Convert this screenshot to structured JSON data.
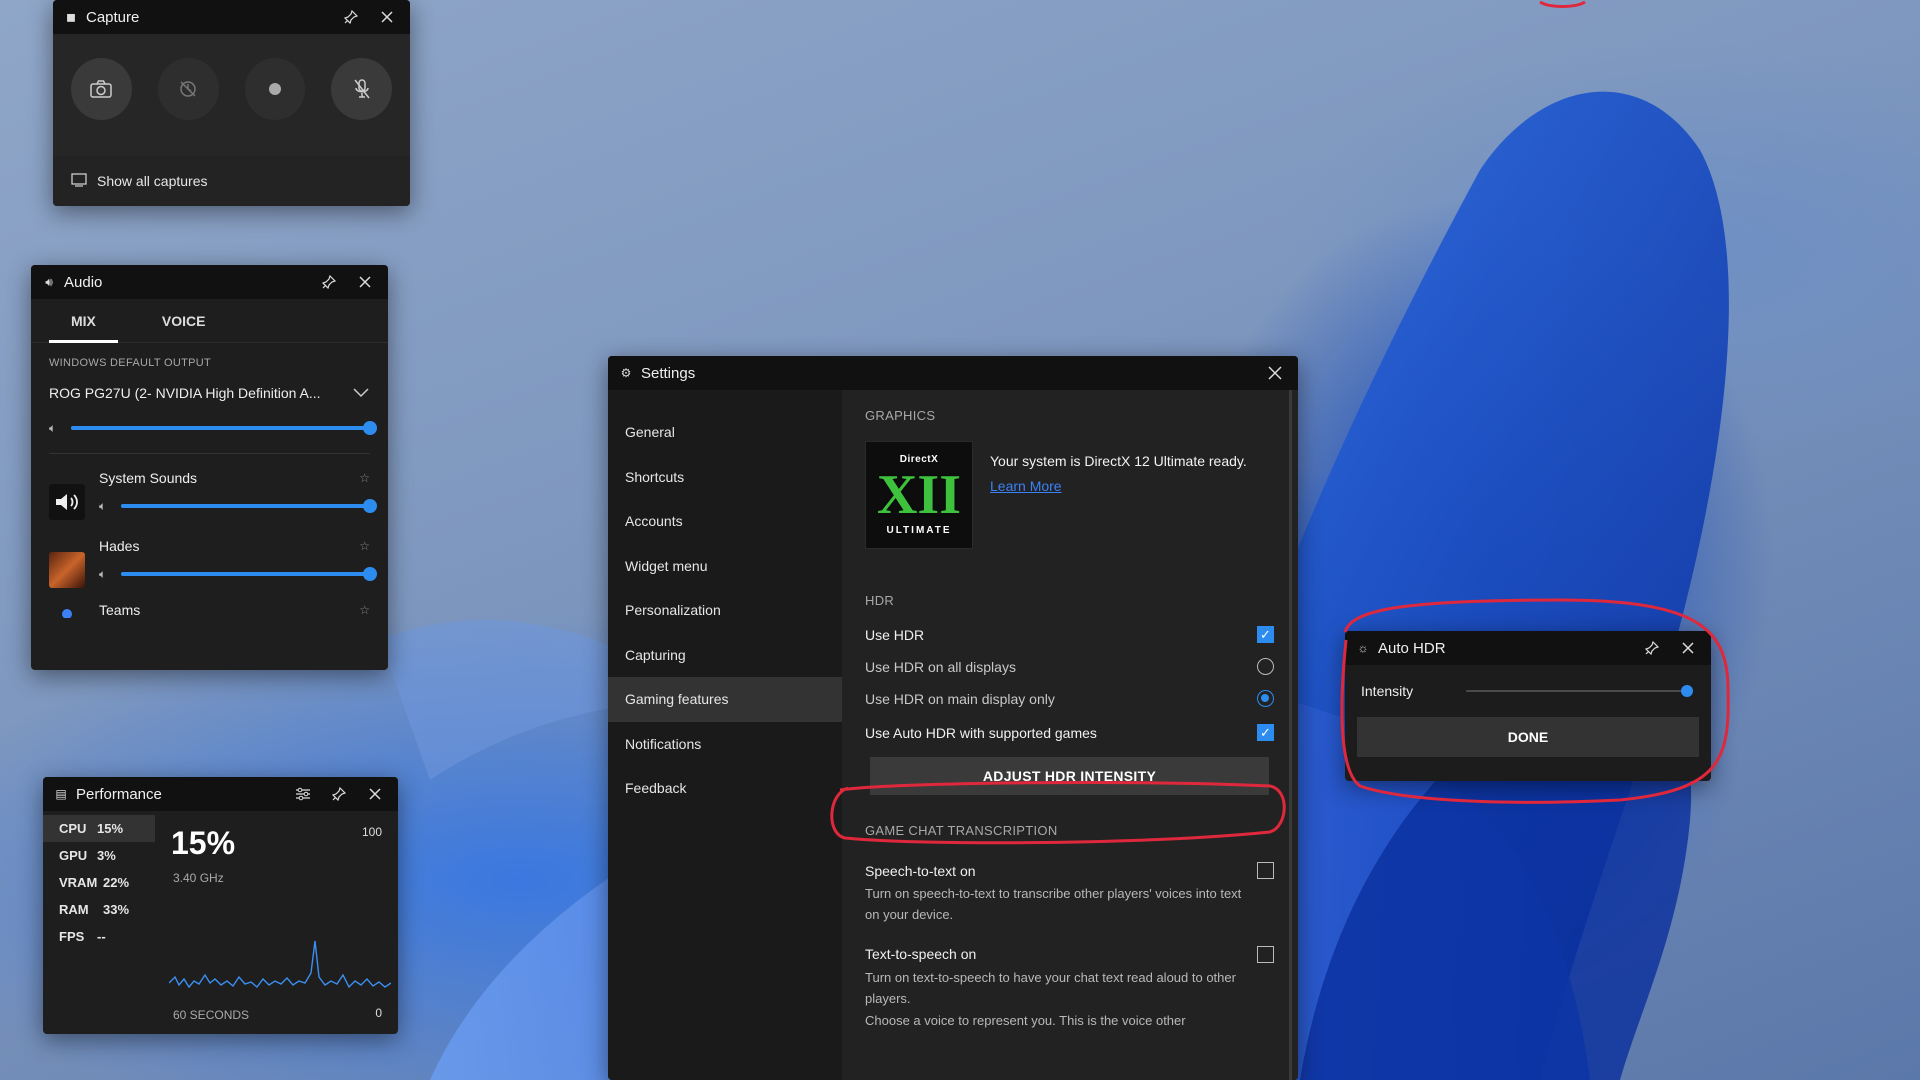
{
  "capture": {
    "title": "Capture",
    "buttons": [
      {
        "name": "screenshot",
        "icon": "camera-icon"
      },
      {
        "name": "record-last",
        "icon": "record-last-icon"
      },
      {
        "name": "start-recording",
        "icon": "record-dot-icon"
      },
      {
        "name": "mic-toggle",
        "icon": "mic-off-icon"
      }
    ],
    "show_all": "Show all captures"
  },
  "audio": {
    "title": "Audio",
    "tabs": [
      "MIX",
      "VOICE"
    ],
    "active_tab": "MIX",
    "output_label": "WINDOWS DEFAULT OUTPUT",
    "device": "ROG PG27U (2- NVIDIA High Definition A...",
    "master_volume": 1.0,
    "apps": [
      {
        "name": "System Sounds",
        "volume": 1.0
      },
      {
        "name": "Hades",
        "volume": 1.0
      },
      {
        "name": "Teams"
      }
    ]
  },
  "performance": {
    "title": "Performance",
    "metrics": [
      {
        "key": "CPU",
        "value": "15%"
      },
      {
        "key": "GPU",
        "value": "3%"
      },
      {
        "key": "VRAM",
        "value": "22%"
      },
      {
        "key": "RAM",
        "value": "33%"
      },
      {
        "key": "FPS",
        "value": "--"
      }
    ],
    "big_value": "15%",
    "frequency": "3.40 GHz",
    "max": "100",
    "min": "0",
    "window": "60 SECONDS"
  },
  "settings": {
    "title": "Settings",
    "nav": [
      "General",
      "Shortcuts",
      "Accounts",
      "Widget menu",
      "Personalization",
      "Capturing",
      "Gaming features",
      "Notifications",
      "Feedback"
    ],
    "active_nav": "Gaming features",
    "graphics_header": "GRAPHICS",
    "dx_logo_top": "DirectX",
    "dx_logo_mid": "XII",
    "dx_logo_bot": "ULTIMATE",
    "dx_text": "Your system is DirectX 12 Ultimate ready.",
    "dx_link": "Learn More",
    "hdr_header": "HDR",
    "use_hdr": "Use HDR",
    "hdr_all": "Use HDR on all displays",
    "hdr_main": "Use HDR on main display only",
    "auto_hdr": "Use Auto HDR with supported games",
    "adjust_button": "ADJUST HDR INTENSITY",
    "chat_header": "GAME CHAT TRANSCRIPTION",
    "stt": "Speech-to-text on",
    "stt_desc": "Turn on speech-to-text to transcribe other players' voices into text on your device.",
    "tts": "Text-to-speech on",
    "tts_desc": "Turn on text-to-speech to have your chat text read aloud to other players.",
    "tts_desc2": "Choose a voice to represent you. This is the voice other"
  },
  "autohdr": {
    "title": "Auto HDR",
    "intensity_label": "Intensity",
    "intensity": 1.0,
    "done": "DONE"
  },
  "colors": {
    "accent": "#2c8cf0",
    "annotation": "#e0283c",
    "dx_green": "#3ec23e"
  }
}
